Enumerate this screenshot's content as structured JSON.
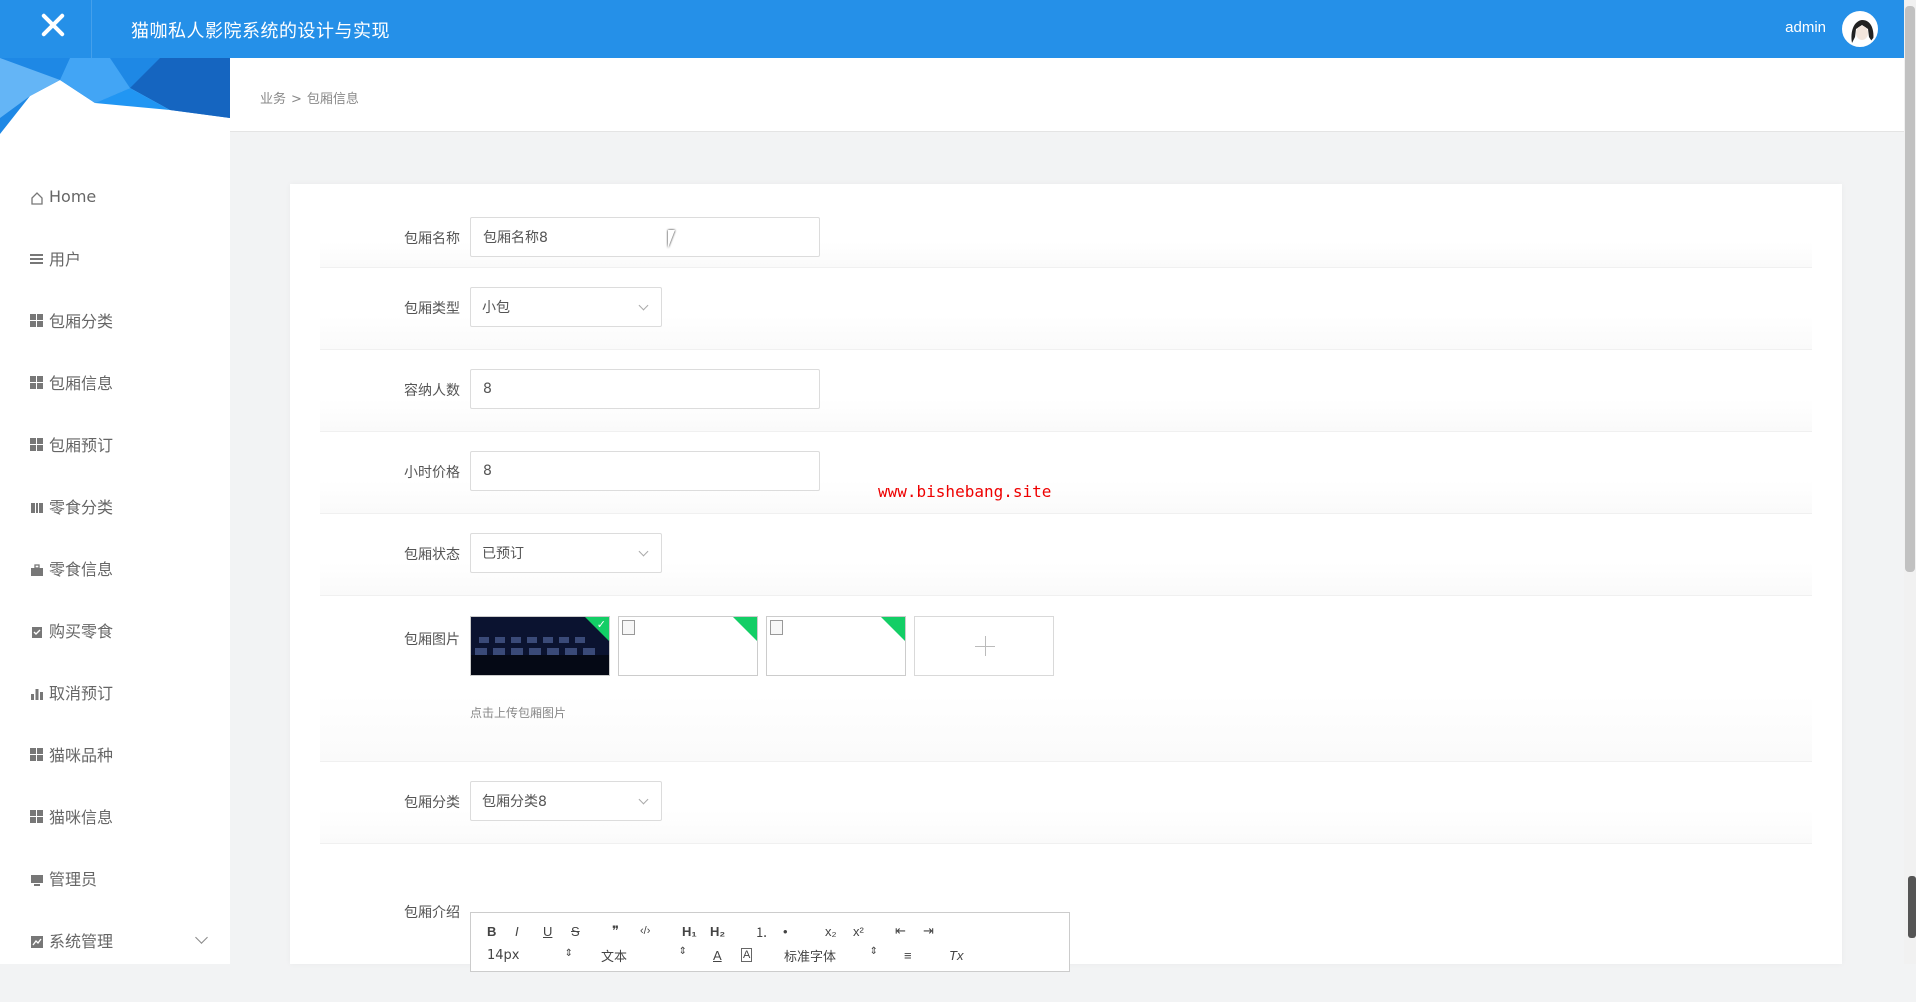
{
  "header": {
    "title": "猫咖私人影院系统的设计与实现",
    "user": "admin",
    "accent": "#2590e8"
  },
  "sidebar": {
    "items": [
      {
        "label": "Home",
        "icon": "home-icon"
      },
      {
        "label": "用户",
        "icon": "list-icon"
      },
      {
        "label": "包厢分类",
        "icon": "grid-icon"
      },
      {
        "label": "包厢信息",
        "icon": "grid-icon"
      },
      {
        "label": "包厢预订",
        "icon": "grid-icon"
      },
      {
        "label": "零食分类",
        "icon": "book-icon"
      },
      {
        "label": "零食信息",
        "icon": "briefcase-icon"
      },
      {
        "label": "购买零食",
        "icon": "clipboard-icon"
      },
      {
        "label": "取消预订",
        "icon": "bar-chart-icon"
      },
      {
        "label": "猫咪品种",
        "icon": "grid-icon"
      },
      {
        "label": "猫咪信息",
        "icon": "grid-icon"
      },
      {
        "label": "管理员",
        "icon": "monitor-icon"
      },
      {
        "label": "系统管理",
        "icon": "chart-icon"
      }
    ]
  },
  "breadcrumb": {
    "parent": "业务",
    "separator": ">",
    "current": "包厢信息"
  },
  "form": {
    "name_label": "包厢名称",
    "name_placeholder": "包厢名称8",
    "type_label": "包厢类型",
    "type_value": "小包",
    "capacity_label": "容纳人数",
    "capacity_value": "8",
    "price_label": "小时价格",
    "price_value": "8",
    "status_label": "包厢状态",
    "status_value": "已预订",
    "image_label": "包厢图片",
    "upload_hint": "点击上传包厢图片",
    "category_label": "包厢分类",
    "category_value": "包厢分类8",
    "intro_label": "包厢介绍"
  },
  "editor": {
    "buttons_row1": [
      "B",
      "I",
      "U",
      "S",
      "❞",
      "‹/›",
      "H₁",
      "H₂",
      "⒈",
      "•",
      "x₂",
      "x²",
      "⇤",
      "⇥"
    ],
    "font_size": "14px",
    "header_select": "文本",
    "font_family": "标准字体",
    "color_btn": "A",
    "bg_btn": "A",
    "align_btn": "≡",
    "clear_btn": "Tx"
  },
  "watermark": "www.bishebang.site"
}
